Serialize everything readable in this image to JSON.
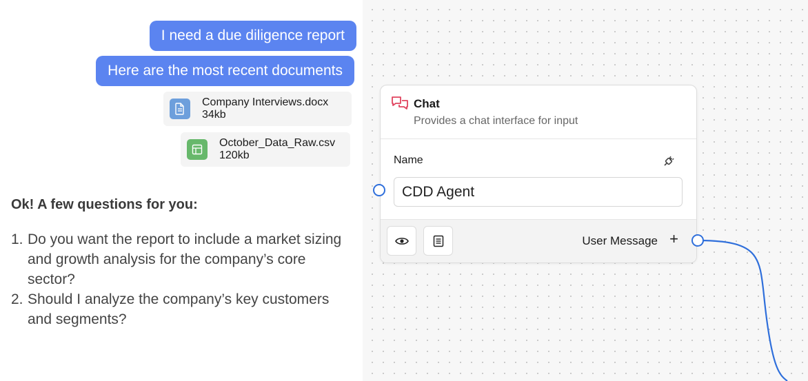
{
  "chat": {
    "messages": [
      {
        "text": "I need a due diligence report"
      },
      {
        "text": "Here are the most recent documents"
      }
    ],
    "attachments": [
      {
        "name": "Company Interviews.docx",
        "size": "34kb",
        "icon": "document-icon",
        "color": "#6d9fdc"
      },
      {
        "name": "October_Data_Raw.csv",
        "size": "120kb",
        "icon": "spreadsheet-icon",
        "color": "#67b86b"
      }
    ],
    "reply_title": "Ok! A few questions for you:",
    "questions": [
      {
        "num": "1.",
        "text": "Do you want the report to include a market sizing and growth analysis for the company’s core sector?"
      },
      {
        "num": "2.",
        "text": "Should I analyze the company’s key customers and segments?"
      }
    ],
    "bubble_color": "#5b84f0"
  },
  "node": {
    "title": "Chat",
    "subtitle": "Provides a chat interface for input",
    "icon": "chat-bubbles-icon",
    "field_label": "Name",
    "field_value": "CDD Agent",
    "footer": {
      "preview_icon": "eye-icon",
      "notes_icon": "document-list-icon",
      "output_label": "User Message",
      "add_symbol": "+"
    }
  },
  "colors": {
    "accent": "#2f6fdb",
    "chat_icon": "#e0445f"
  }
}
